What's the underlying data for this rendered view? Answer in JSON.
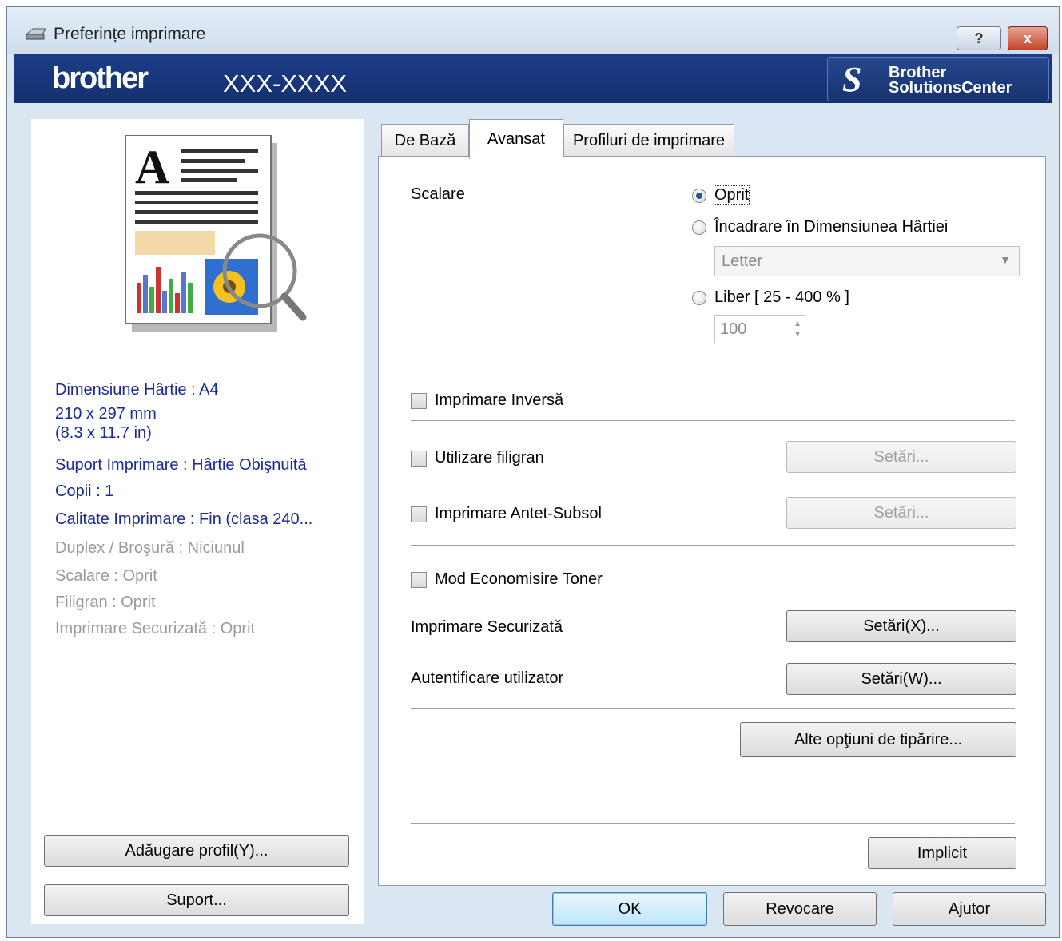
{
  "window": {
    "title": "Preferințe imprimare",
    "help_button": "?",
    "close_button": "x"
  },
  "banner": {
    "brand": "brother",
    "model": "XXX-XXXX",
    "solutions_line1": "Brother",
    "solutions_line2": "SolutionsCenter"
  },
  "summary": {
    "paper_size": "Dimensiune Hârtie : A4",
    "paper_mm": "210 x 297 mm",
    "paper_in": "(8.3 x 11.7 in)",
    "media": "Suport Imprimare : Hârtie Obişnuită",
    "copies": "Copii : 1",
    "quality": "Calitate Imprimare : Fin (clasa 240...",
    "duplex": "Duplex / Broşură : Niciunul",
    "scaling": "Scalare : Oprit",
    "watermark": "Filigran : Oprit",
    "secure": "Imprimare Securizată : Oprit"
  },
  "left_buttons": {
    "add_profile": "Adăugare profil(Y)...",
    "support": "Suport..."
  },
  "tabs": [
    "De Bază",
    "Avansat",
    "Profiluri de imprimare"
  ],
  "active_tab": "Avansat",
  "advanced": {
    "scaling_label": "Scalare",
    "scaling_off": "Oprit",
    "scaling_fit": "Încadrare în Dimensiunea Hârtiei",
    "scaling_fit_select": "Letter",
    "scaling_free": "Liber [ 25 - 400 % ]",
    "scaling_free_value": "100",
    "scaling_selected": "Oprit",
    "reverse_print": "Imprimare Inversă",
    "use_watermark": "Utilizare filigran",
    "header_footer": "Imprimare Antet-Subsol",
    "toner_save": "Mod Economisire Toner",
    "secure_print": "Imprimare Securizată",
    "user_auth": "Autentificare utilizator",
    "settings_label": "Setări...",
    "secure_settings": "Setări(X)...",
    "auth_settings": "Setări(W)...",
    "other_options": "Alte opţiuni de tipărire...",
    "default_button": "Implicit"
  },
  "dialog_buttons": {
    "ok": "OK",
    "cancel": "Revocare",
    "help": "Ajutor"
  },
  "colors": {
    "banner": "#17336f",
    "summary_text": "#1a2a9a",
    "window_bg": "#dbe6f3"
  }
}
